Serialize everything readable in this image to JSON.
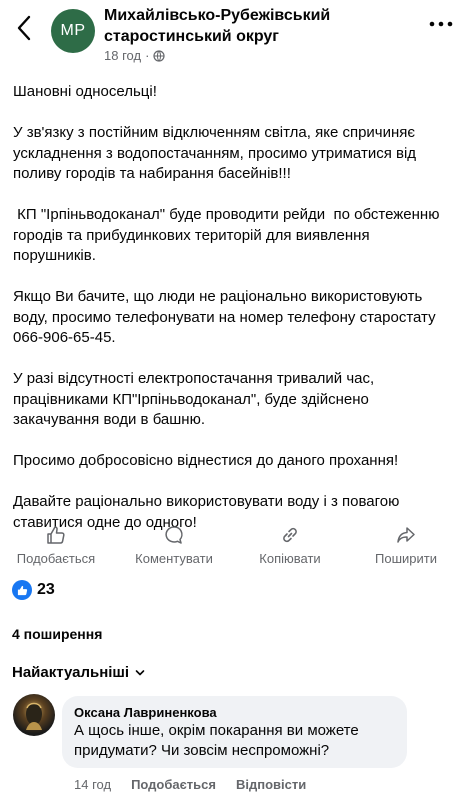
{
  "header": {
    "avatar_initials": "MP",
    "page_name": "Михайлівсько-Рубежівський старостинський округ",
    "time": "18 год",
    "dot": "·"
  },
  "post": {
    "paragraphs": [
      "Шановні односельці!",
      "У зв'язку з постійним відключенням світла, яке спричиняє ускладнення з водопостачанням, просимо утриматися від поливу городів та набирання басейнів!!!",
      " КП \"Ірпіньводоканал\" буде проводити рейди  по обстеженню городів та прибудинкових територій для виявлення порушників.",
      "Якщо Ви бачите, що люди не раціонально використовують воду, просимо телефонувати на номер телефону старостату 066-906-65-45.",
      "У разі відсутності електропостачання тривалий час, працівниками КП\"Ірпіньводоканал\", буде здійснено закачування води в башню.",
      "Просимо добросовісно віднестися до даного прохання!",
      "Давайте раціонально використовувати воду і з повагою ставитися одне до одного!"
    ]
  },
  "actions": {
    "like": "Подобається",
    "comment": "Коментувати",
    "copy": "Копіювати",
    "share": "Поширити"
  },
  "reactions": {
    "count": "23"
  },
  "shares": {
    "text": "4 поширення"
  },
  "sort": {
    "label": "Найактуальніші"
  },
  "comment": {
    "author": "Оксана Лавриненкова",
    "text": "А щось інше, окрім покарання ви можете придумати? Чи зовсім неспроможні?",
    "time": "14 год",
    "like": "Подобається",
    "reply": "Відповісти"
  },
  "colors": {
    "accent": "#1877f2",
    "secondary_text": "#65676b",
    "bubble": "#f0f2f5"
  }
}
